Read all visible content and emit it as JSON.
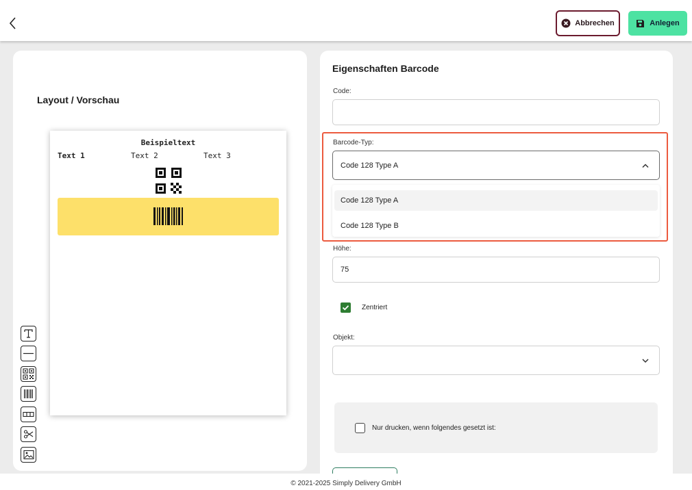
{
  "header": {
    "back_icon": "chevron-left-icon",
    "cancel_label": "Abbrechen",
    "save_label": "Anlegen",
    "cancel_border_color": "#6b1a2e",
    "save_bg_color": "#4de2a2"
  },
  "layout_panel": {
    "title": "Layout / Vorschau",
    "preview": {
      "sample_title": "Beispieltext",
      "text1": "Text 1",
      "text2": "Text 2",
      "text3": "Text 3",
      "barcode_band_color": "#fde06a"
    },
    "tools": [
      {
        "name": "text-tool",
        "icon": "text-T-icon"
      },
      {
        "name": "line-tool",
        "icon": "horizontal-line-icon"
      },
      {
        "name": "qr-tool",
        "icon": "qr-code-icon"
      },
      {
        "name": "barcode-tool",
        "icon": "barcode-icon"
      },
      {
        "name": "box-tool",
        "icon": "columns-box-icon"
      },
      {
        "name": "cut-tool",
        "icon": "scissors-icon"
      },
      {
        "name": "image-tool",
        "icon": "image-icon"
      }
    ]
  },
  "properties": {
    "title": "Eigenschaften Barcode",
    "code_label": "Code:",
    "code_value": "",
    "barcode_type_label": "Barcode-Typ:",
    "barcode_type_value": "Code 128 Type A",
    "barcode_type_options": [
      "Code 128 Type A",
      "Code 128 Type B"
    ],
    "height_label": "Höhe:",
    "height_value": "75",
    "centered_label": "Zentriert",
    "centered_checked": true,
    "object_label": "Objekt:",
    "object_value": "",
    "condition_label": "Nur drucken, wenn folgendes gesetzt ist:",
    "condition_checked": false,
    "highlight_color": "#ec5a3e"
  },
  "footer": {
    "copyright": "© 2021-2025 Simply Delivery GmbH"
  }
}
